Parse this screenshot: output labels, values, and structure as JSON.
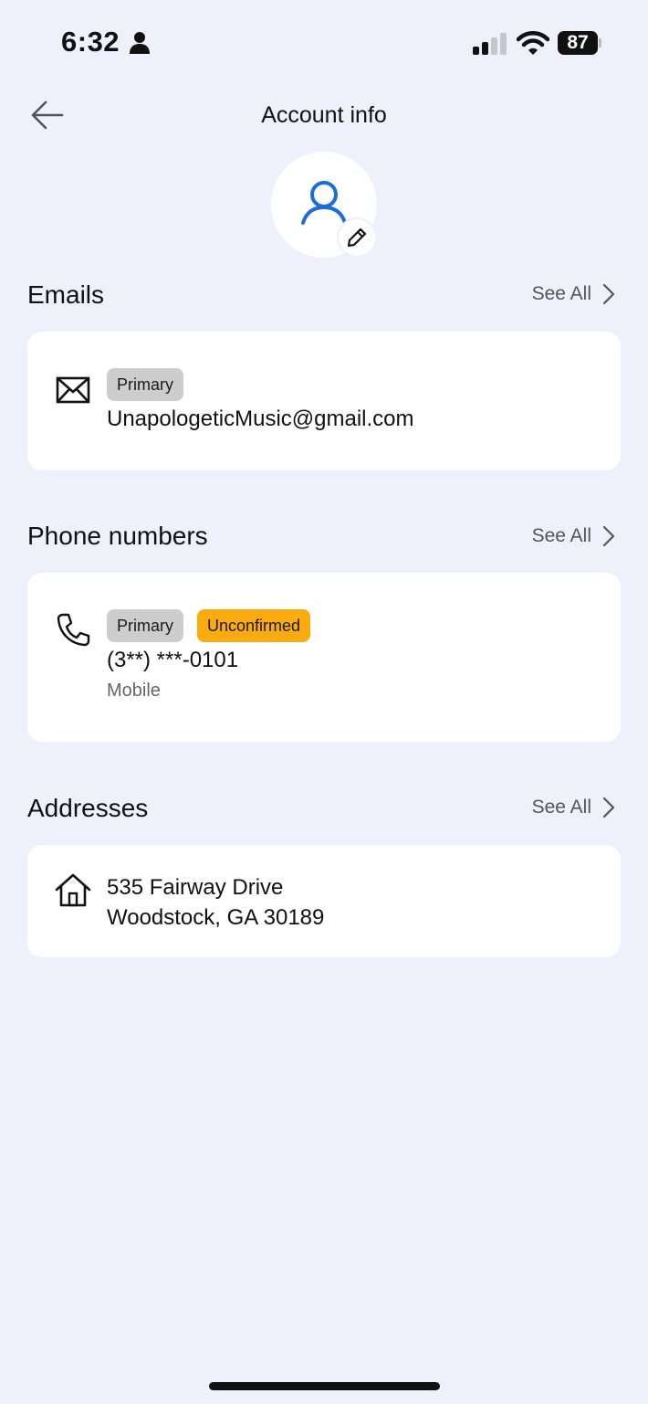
{
  "status_bar": {
    "time": "6:32",
    "battery": "87",
    "icons": [
      "person-icon",
      "signal-icon",
      "wifi-icon",
      "battery-icon"
    ]
  },
  "header": {
    "title": "Account info",
    "back_icon": "arrow-left-icon"
  },
  "avatar": {
    "icon": "user-icon",
    "edit_icon": "pencil-icon",
    "accent_color": "#1a6ddb"
  },
  "sections": {
    "emails": {
      "title": "Emails",
      "see_all": "See All",
      "items": [
        {
          "icon": "envelope-icon",
          "badges": [
            "Primary"
          ],
          "value": "UnapologeticMusic@gmail.com"
        }
      ]
    },
    "phones": {
      "title": "Phone numbers",
      "see_all": "See All",
      "items": [
        {
          "icon": "phone-icon",
          "badges": [
            "Primary",
            "Unconfirmed"
          ],
          "value": "(3**) ***-0101",
          "type": "Mobile"
        }
      ]
    },
    "addresses": {
      "title": "Addresses",
      "see_all": "See All",
      "items": [
        {
          "icon": "home-icon",
          "line1": "535 Fairway Drive",
          "line2": "Woodstock, GA 30189"
        }
      ]
    }
  },
  "colors": {
    "background": "#eef1fb",
    "card": "#ffffff",
    "badge_primary": "#cdcdcd",
    "badge_unconfirmed": "#f9ab10"
  }
}
